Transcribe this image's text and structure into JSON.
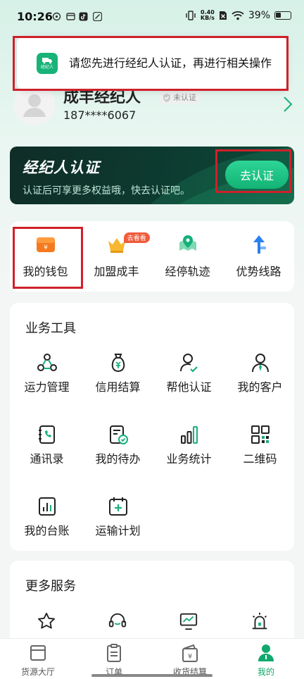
{
  "status_bar": {
    "time": "10:26",
    "net_speed_value": "0.40",
    "net_speed_unit": "KB/s",
    "battery": "39%"
  },
  "toast": {
    "logo_text": "经纪人",
    "message": "请您先进行经纪人认证，再进行相关操作"
  },
  "profile": {
    "name": "成丰经纪人",
    "verify_status": "未认证",
    "phone": "187****6067"
  },
  "banner": {
    "title": "经纪人认证",
    "subtitle": "认证后可享更多权益哦，快去认证吧。",
    "button_label": "去认证"
  },
  "quick_actions": [
    {
      "label": "我的钱包",
      "icon": "wallet-icon"
    },
    {
      "label": "加盟成丰",
      "icon": "crown-icon",
      "badge": "去看看"
    },
    {
      "label": "经停轨迹",
      "icon": "map-pin-icon"
    },
    {
      "label": "优势线路",
      "icon": "route-arrow-icon"
    }
  ],
  "tools": {
    "title": "业务工具",
    "items": [
      {
        "label": "运力管理",
        "icon": "capacity-icon"
      },
      {
        "label": "信用结算",
        "icon": "money-bag-icon"
      },
      {
        "label": "帮他认证",
        "icon": "user-check-icon"
      },
      {
        "label": "我的客户",
        "icon": "customer-icon"
      },
      {
        "label": "通讯录",
        "icon": "contacts-icon"
      },
      {
        "label": "我的待办",
        "icon": "todo-icon"
      },
      {
        "label": "业务统计",
        "icon": "bar-stats-icon"
      },
      {
        "label": "二维码",
        "icon": "qr-code-icon"
      },
      {
        "label": "我的台账",
        "icon": "ledger-icon"
      },
      {
        "label": "运输计划",
        "icon": "calendar-plus-icon"
      }
    ]
  },
  "more_services": {
    "title": "更多服务",
    "items": [
      {
        "icon": "star-icon"
      },
      {
        "icon": "headset-icon"
      },
      {
        "icon": "monitor-chart-icon"
      },
      {
        "icon": "alarm-icon"
      }
    ]
  },
  "bottom_nav": [
    {
      "label": "货源大厅",
      "icon": "cargo-hall-icon"
    },
    {
      "label": "订单",
      "icon": "order-icon"
    },
    {
      "label": "收货结算",
      "icon": "settlement-icon"
    },
    {
      "label": "我的",
      "icon": "me-icon",
      "active": true
    }
  ],
  "colors": {
    "brand_green": "#11a86d",
    "highlight_red": "#d0202b",
    "banner_dark": "#0f2d27"
  }
}
